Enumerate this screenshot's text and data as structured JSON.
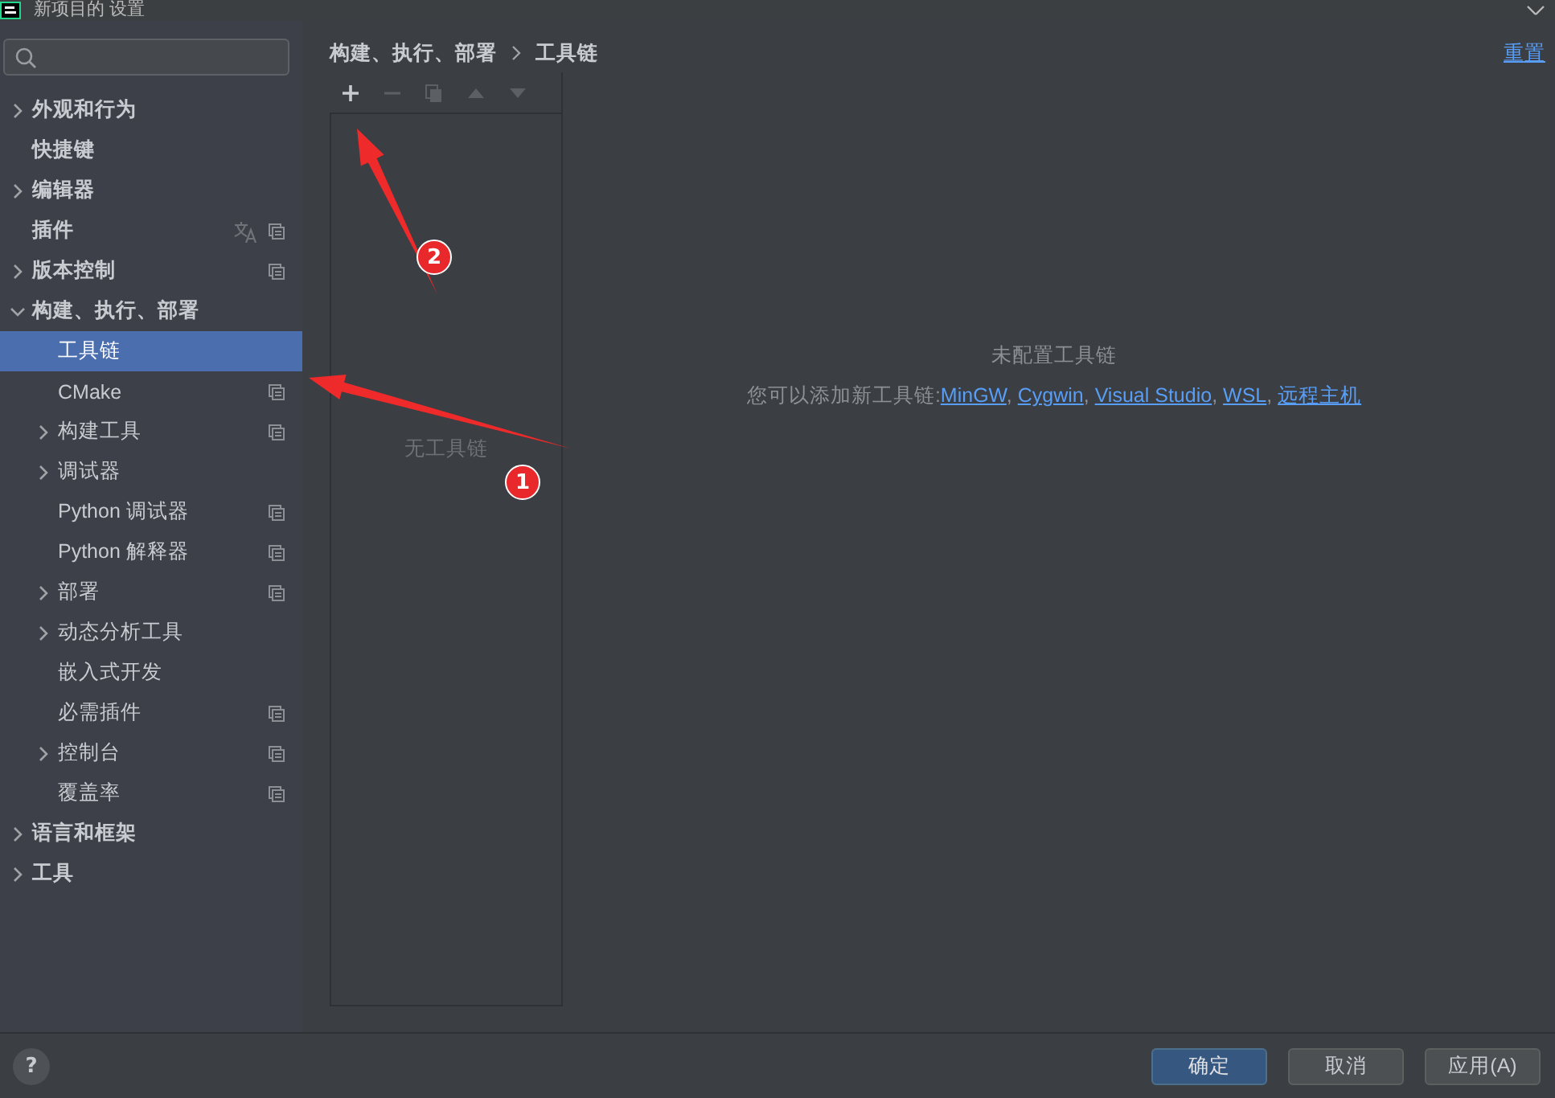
{
  "window": {
    "title": "新项目的 设置"
  },
  "sidebar": {
    "items": [
      {
        "label": "外观和行为",
        "kind": "folder",
        "expanded": false,
        "selected": false,
        "project_scope": false,
        "translate_icon": false
      },
      {
        "label": "快捷键",
        "kind": "page",
        "selected": false,
        "project_scope": false,
        "translate_icon": false
      },
      {
        "label": "编辑器",
        "kind": "folder",
        "expanded": false,
        "selected": false,
        "project_scope": false,
        "translate_icon": false
      },
      {
        "label": "插件",
        "kind": "page",
        "selected": false,
        "project_scope": true,
        "translate_icon": true
      },
      {
        "label": "版本控制",
        "kind": "folder",
        "expanded": false,
        "selected": false,
        "project_scope": true,
        "translate_icon": false
      },
      {
        "label": "构建、执行、部署",
        "kind": "folder",
        "expanded": true,
        "selected": false,
        "project_scope": false,
        "translate_icon": false,
        "children": [
          {
            "label": "工具链",
            "kind": "page",
            "selected": true,
            "project_scope": false,
            "translate_icon": false
          },
          {
            "label": "CMake",
            "kind": "page",
            "selected": false,
            "project_scope": true,
            "translate_icon": false
          },
          {
            "label": "构建工具",
            "kind": "folder",
            "expanded": false,
            "selected": false,
            "project_scope": true,
            "translate_icon": false
          },
          {
            "label": "调试器",
            "kind": "folder",
            "expanded": false,
            "selected": false,
            "project_scope": false,
            "translate_icon": false
          },
          {
            "label": "Python 调试器",
            "kind": "page",
            "selected": false,
            "project_scope": true,
            "translate_icon": false
          },
          {
            "label": "Python 解释器",
            "kind": "page",
            "selected": false,
            "project_scope": true,
            "translate_icon": false
          },
          {
            "label": "部署",
            "kind": "folder",
            "expanded": false,
            "selected": false,
            "project_scope": true,
            "translate_icon": false
          },
          {
            "label": "动态分析工具",
            "kind": "folder",
            "expanded": false,
            "selected": false,
            "project_scope": false,
            "translate_icon": false
          },
          {
            "label": "嵌入式开发",
            "kind": "page",
            "selected": false,
            "project_scope": false,
            "translate_icon": false
          },
          {
            "label": "必需插件",
            "kind": "page",
            "selected": false,
            "project_scope": true,
            "translate_icon": false
          },
          {
            "label": "控制台",
            "kind": "folder",
            "expanded": false,
            "selected": false,
            "project_scope": true,
            "translate_icon": false
          },
          {
            "label": "覆盖率",
            "kind": "page",
            "selected": false,
            "project_scope": true,
            "translate_icon": false
          }
        ]
      },
      {
        "label": "语言和框架",
        "kind": "folder",
        "expanded": false,
        "selected": false,
        "project_scope": false,
        "translate_icon": false
      },
      {
        "label": "工具",
        "kind": "folder",
        "expanded": false,
        "selected": false,
        "project_scope": false,
        "translate_icon": false
      }
    ]
  },
  "content": {
    "breadcrumb": [
      "构建、执行、部署",
      "工具链"
    ],
    "reset": "重置",
    "toolbar": [
      {
        "kind": "add",
        "disabled": false
      },
      {
        "kind": "remove",
        "disabled": true
      },
      {
        "kind": "copy",
        "disabled": true
      },
      {
        "kind": "up",
        "disabled": true
      },
      {
        "kind": "down",
        "disabled": true
      }
    ],
    "list_empty_text": "无工具链",
    "empty_state": {
      "title": "未配置工具链",
      "text": "您可以添加新工具链:",
      "separator": ", ",
      "links": [
        "MinGW",
        "Cygwin",
        "Visual Studio",
        "WSL",
        "远程主机"
      ]
    }
  },
  "footer": {
    "help": "?",
    "buttons": [
      {
        "label": "确定",
        "primary": true
      },
      {
        "label": "取消",
        "primary": false
      },
      {
        "label": "应用(A)",
        "primary": false
      }
    ]
  },
  "annotations": [
    {
      "number": "1"
    },
    {
      "number": "2"
    }
  ]
}
